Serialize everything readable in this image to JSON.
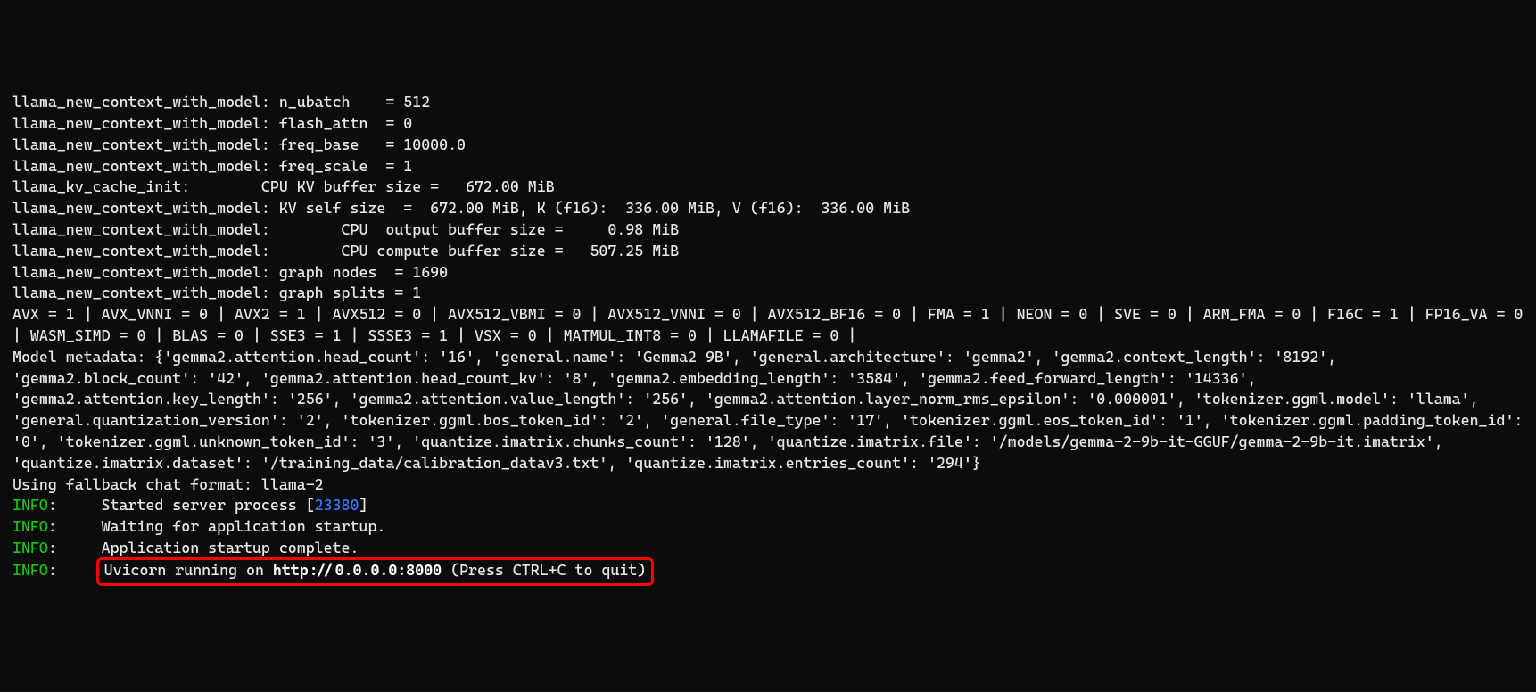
{
  "lines": {
    "l1": "llama_new_context_with_model: n_ubatch    = 512",
    "l2": "llama_new_context_with_model: flash_attn  = 0",
    "l3": "llama_new_context_with_model: freq_base   = 10000.0",
    "l4": "llama_new_context_with_model: freq_scale  = 1",
    "l5": "llama_kv_cache_init:        CPU KV buffer size =   672.00 MiB",
    "l6": "llama_new_context_with_model: KV self size  =  672.00 MiB, K (f16):  336.00 MiB, V (f16):  336.00 MiB",
    "l7": "llama_new_context_with_model:        CPU  output buffer size =     0.98 MiB",
    "l8": "llama_new_context_with_model:        CPU compute buffer size =   507.25 MiB",
    "l9": "llama_new_context_with_model: graph nodes  = 1690",
    "l10": "llama_new_context_with_model: graph splits = 1",
    "l11": "AVX = 1 | AVX_VNNI = 0 | AVX2 = 1 | AVX512 = 0 | AVX512_VBMI = 0 | AVX512_VNNI = 0 | AVX512_BF16 = 0 | FMA = 1 | NEON = 0 | SVE = 0 | ARM_FMA = 0 | F16C = 1 | FP16_VA = 0 | WASM_SIMD = 0 | BLAS = 0 | SSE3 = 1 | SSSE3 = 1 | VSX = 0 | MATMUL_INT8 = 0 | LLAMAFILE = 0 | ",
    "l12": "Model metadata: {'gemma2.attention.head_count': '16', 'general.name': 'Gemma2 9B', 'general.architecture': 'gemma2', 'gemma2.context_length': '8192', 'gemma2.block_count': '42', 'gemma2.attention.head_count_kv': '8', 'gemma2.embedding_length': '3584', 'gemma2.feed_forward_length': '14336', 'gemma2.attention.key_length': '256', 'gemma2.attention.value_length': '256', 'gemma2.attention.layer_norm_rms_epsilon': '0.000001', 'tokenizer.ggml.model': 'llama', 'general.quantization_version': '2', 'tokenizer.ggml.bos_token_id': '2', 'general.file_type': '17', 'tokenizer.ggml.eos_token_id': '1', 'tokenizer.ggml.padding_token_id': '0', 'tokenizer.ggml.unknown_token_id': '3', 'quantize.imatrix.chunks_count': '128', 'quantize.imatrix.file': '/models/gemma-2-9b-it-GGUF/gemma-2-9b-it.imatrix', 'quantize.imatrix.dataset': '/training_data/calibration_datav3.txt', 'quantize.imatrix.entries_count': '294'}",
    "l13": "Using fallback chat format: llama-2"
  },
  "info_label": "INFO",
  "info1_msg_a": ":     Started server process [",
  "info1_pid": "23380",
  "info1_msg_b": "]",
  "info2_msg": ":     Waiting for application startup.",
  "info3_msg": ":     Application startup complete.",
  "info4_msg_a": ":     ",
  "info4_uvicorn": "Uvicorn running on ",
  "info4_url": "http://0.0.0.0:8000",
  "info4_quit": " (Press CTRL+C to quit)"
}
